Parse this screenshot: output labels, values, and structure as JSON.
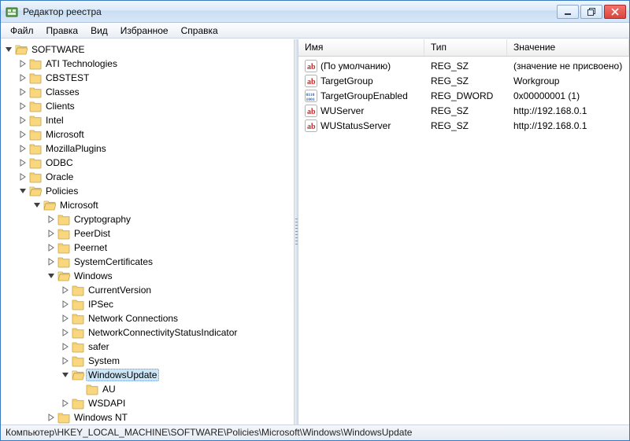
{
  "title": "Редактор реестра",
  "menu": {
    "file": "Файл",
    "edit": "Правка",
    "view": "Вид",
    "favorites": "Избранное",
    "help": "Справка"
  },
  "columns": {
    "name": "Имя",
    "type": "Тип",
    "value": "Значение"
  },
  "values": [
    {
      "icon": "string",
      "name": "(По умолчанию)",
      "type": "REG_SZ",
      "value": "(значение не присвоено)"
    },
    {
      "icon": "string",
      "name": "TargetGroup",
      "type": "REG_SZ",
      "value": "Workgroup"
    },
    {
      "icon": "binary",
      "name": "TargetGroupEnabled",
      "type": "REG_DWORD",
      "value": "0x00000001 (1)"
    },
    {
      "icon": "string",
      "name": "WUServer",
      "type": "REG_SZ",
      "value": "http://192.168.0.1"
    },
    {
      "icon": "string",
      "name": "WUStatusServer",
      "type": "REG_SZ",
      "value": "http://192.168.0.1"
    }
  ],
  "status": "Компьютер\\HKEY_LOCAL_MACHINE\\SOFTWARE\\Policies\\Microsoft\\Windows\\WindowsUpdate",
  "tree": {
    "software": "SOFTWARE",
    "nodes_level1": [
      "ATI Technologies",
      "CBSTEST",
      "Classes",
      "Clients",
      "Intel",
      "Microsoft",
      "MozillaPlugins",
      "ODBC",
      "Oracle"
    ],
    "policies": "Policies",
    "microsoft": "Microsoft",
    "ms_children": [
      "Cryptography",
      "PeerDist",
      "Peernet",
      "SystemCertificates"
    ],
    "windows": "Windows",
    "win_children_before": [
      "CurrentVersion",
      "IPSec",
      "Network Connections",
      "NetworkConnectivityStatusIndicator",
      "safer",
      "System"
    ],
    "windowsupdate": "WindowsUpdate",
    "au": "AU",
    "win_children_after": [
      "WSDAPI"
    ],
    "windows_nt": "Windows NT"
  }
}
